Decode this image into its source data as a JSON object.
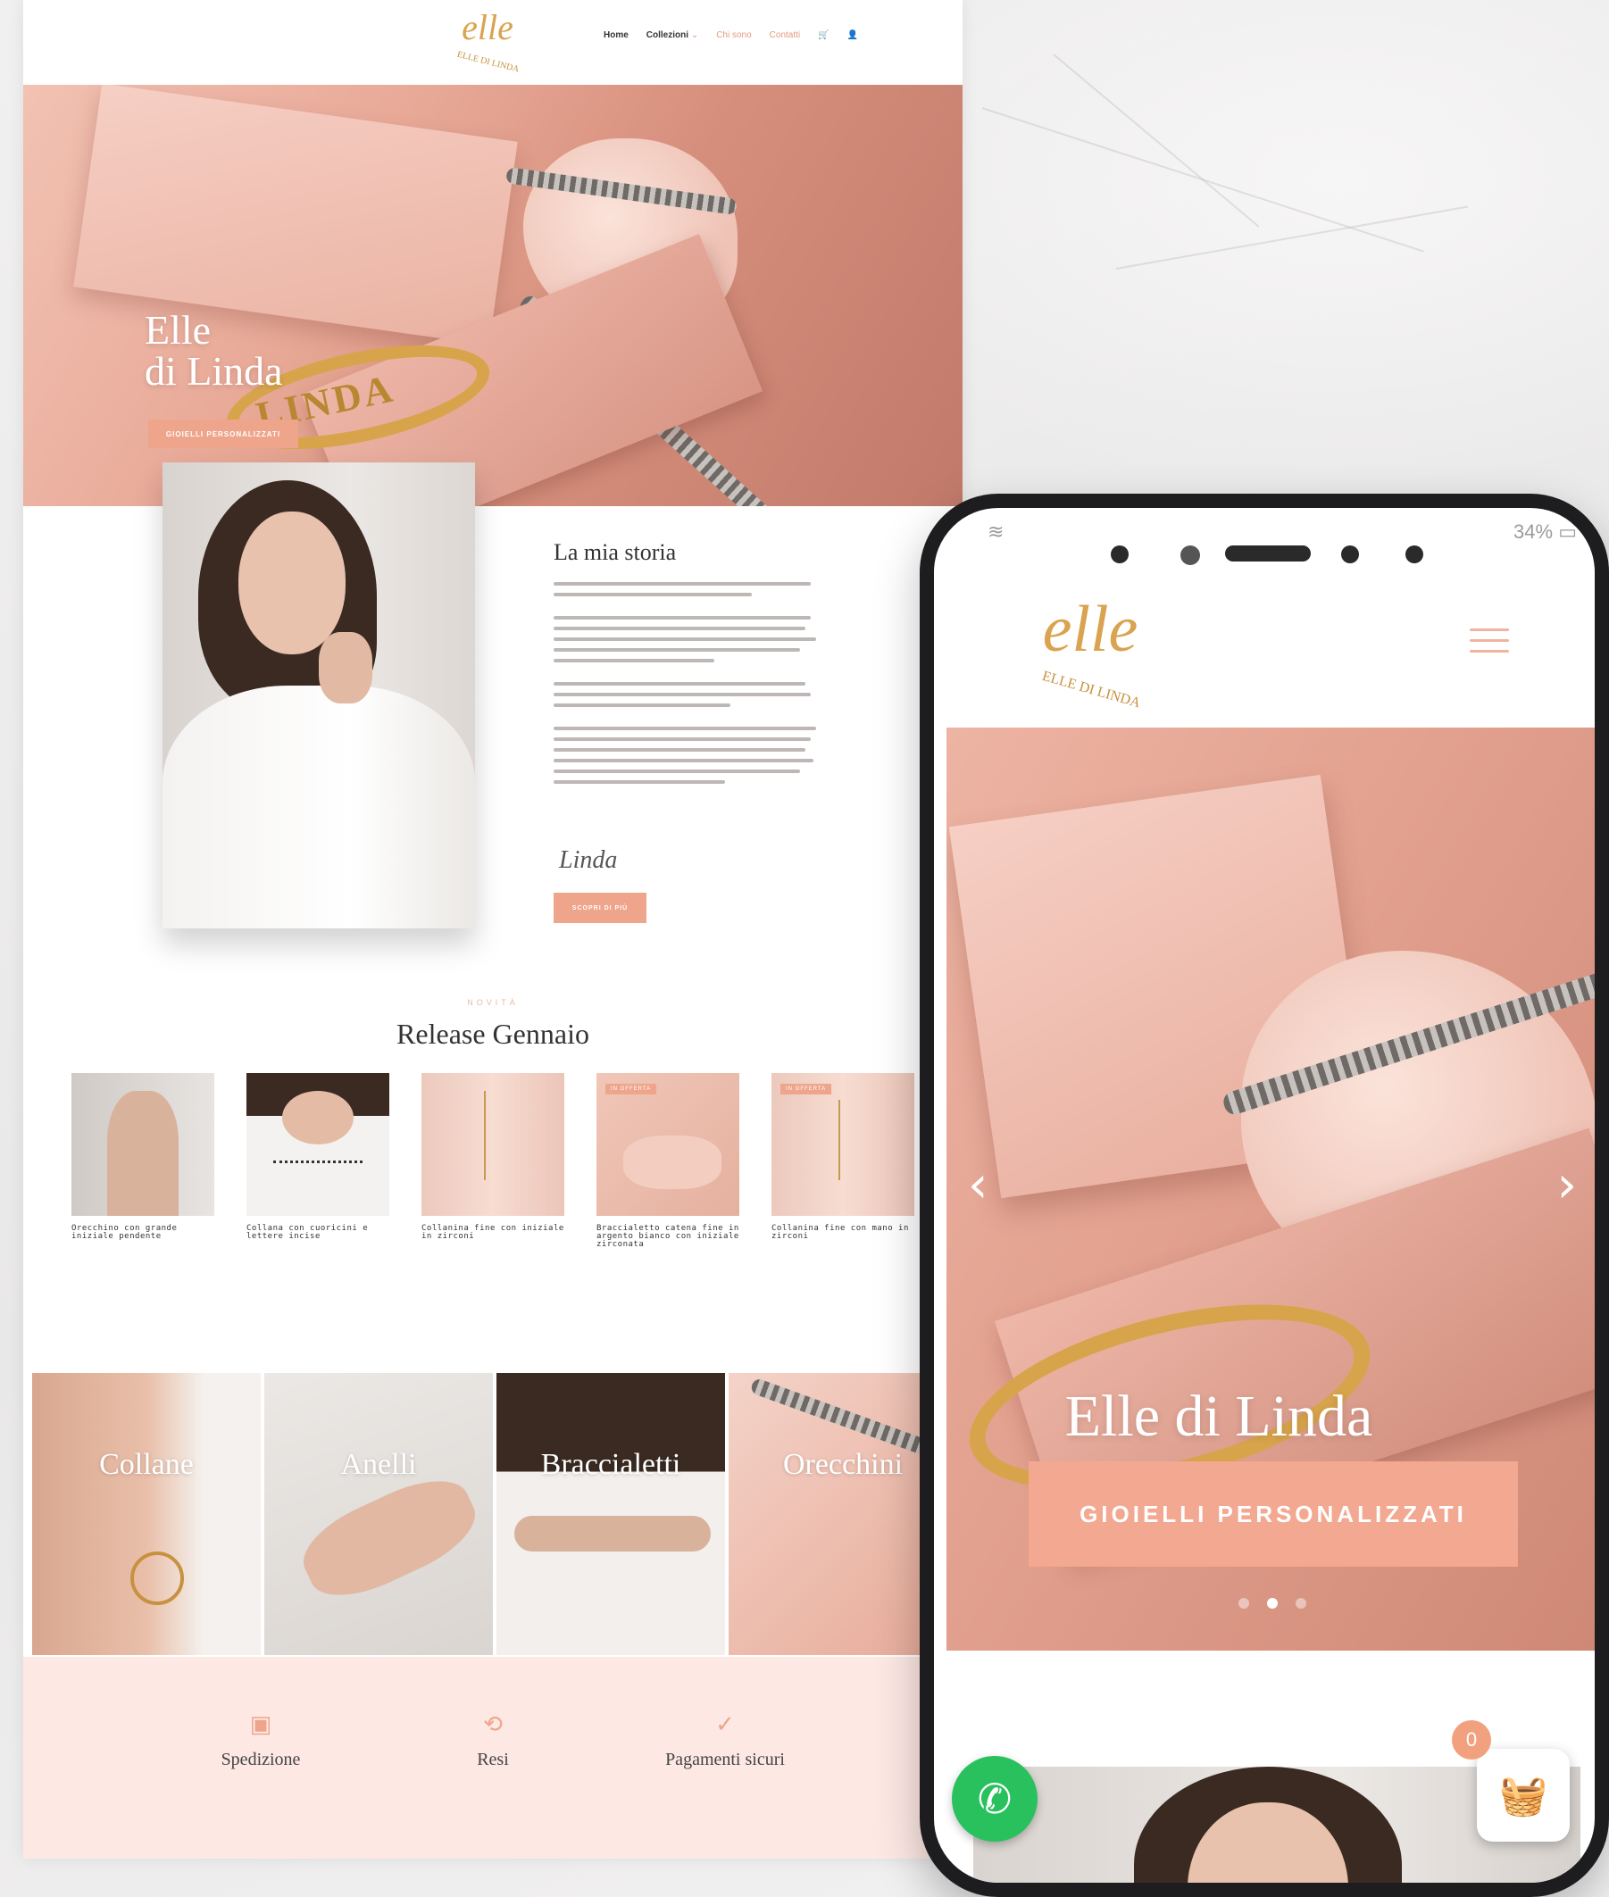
{
  "desktop": {
    "nav": {
      "phone": "",
      "email": "",
      "logo_text": "elle",
      "logo_sub": "ELLE DI LINDA",
      "menu": [
        "Home",
        "Collezioni",
        "Chi sono",
        "Contatti"
      ]
    },
    "hero": {
      "title_line1": "Elle",
      "title_line2": "di Linda",
      "button": "GIOIELLI PERSONALIZZATI",
      "bracelet_text": "LINDA"
    },
    "story": {
      "title": "La mia storia",
      "signature": "Linda",
      "button": "SCOPRI DI PIÙ"
    },
    "release": {
      "overline": "NOVITÀ",
      "title": "Release Gennaio",
      "products": [
        {
          "name": "Orecchino con grande iniziale pendente",
          "badge": "",
          "price": ""
        },
        {
          "name": "Collana con cuoricini e lettere incise",
          "badge": "",
          "price": ""
        },
        {
          "name": "Collanina fine con iniziale in zirconi",
          "badge": "",
          "price": ""
        },
        {
          "name": "Braccialetto catena fine in argento bianco con iniziale zirconata",
          "badge": "IN OFFERTA",
          "price": ""
        },
        {
          "name": "Collanina fine con mano in zirconi",
          "badge": "IN OFFERTA",
          "price": ""
        }
      ]
    },
    "categories": [
      "Collane",
      "Anelli",
      "Braccialetti",
      "Orecchini"
    ],
    "features": [
      {
        "icon": "box-icon",
        "title": "Spedizione",
        "desc": ""
      },
      {
        "icon": "return-icon",
        "title": "Resi",
        "desc": ""
      },
      {
        "icon": "check-icon",
        "title": "Pagamenti sicuri",
        "desc": ""
      }
    ]
  },
  "mobile": {
    "status_left": "",
    "status_right": "34%",
    "logo_text": "elle",
    "logo_sub": "ELLE DI LINDA",
    "hero_title": "Elle di Linda",
    "hero_button": "GIOIELLI PERSONALIZZATI",
    "slider": {
      "count": 3,
      "active": 1
    },
    "cart_count": "0"
  },
  "colors": {
    "accent": "#EEA58B",
    "gold": "#D7A44C",
    "feature_bg": "#FDE8E4",
    "whatsapp": "#29C15D"
  }
}
